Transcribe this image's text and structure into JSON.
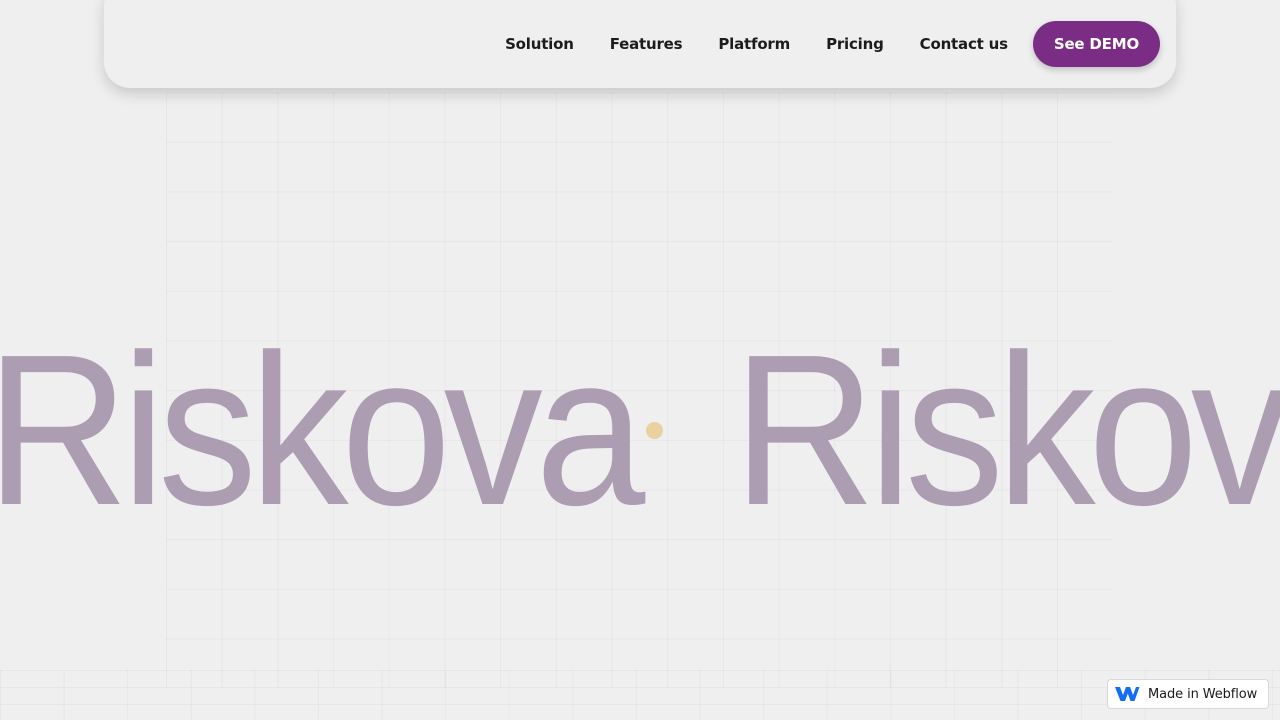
{
  "nav": {
    "links": [
      "Solution",
      "Features",
      "Platform",
      "Pricing",
      "Contact us"
    ],
    "cta_label": "See DEMO"
  },
  "hero": {
    "marquee_text": "Riskova"
  },
  "badge": {
    "label": "Made in Webflow"
  },
  "colors": {
    "brand_purple": "#7b2d86",
    "marquee_text": "#ad9db3",
    "marquee_dot": "#e9d29f",
    "background": "#efefef",
    "webflow_blue": "#146ef5"
  }
}
